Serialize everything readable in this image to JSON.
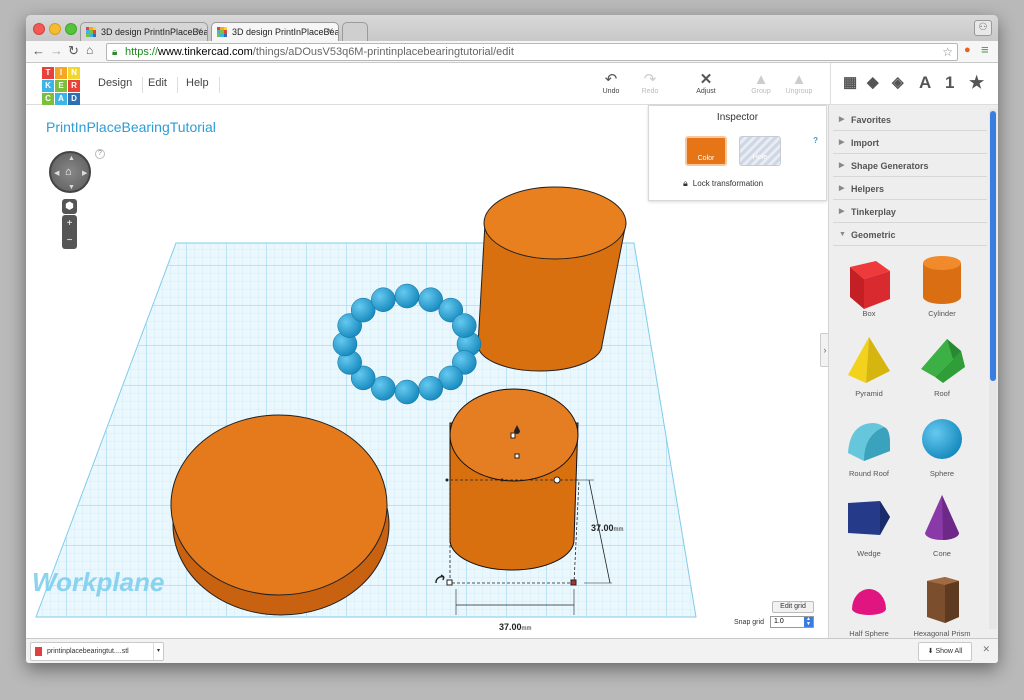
{
  "browser": {
    "tabs": [
      {
        "label": "3D design PrintInPlaceBea"
      },
      {
        "label": "3D design PrintInPlaceBea"
      }
    ],
    "url_https": "https://",
    "url_host": "www.tinkercad.com",
    "url_path": "/things/aDOusV53q6M-printinplacebearingtutorial/edit"
  },
  "app": {
    "logo_letters": [
      "T",
      "I",
      "N",
      "K",
      "E",
      "R",
      "C",
      "A",
      "D"
    ],
    "logo_colors": [
      "#e8413a",
      "#f6a623",
      "#f3d62b",
      "#3cb4e5",
      "#7bbf3f",
      "#e8413a",
      "#7bbf3f",
      "#3cb4e5",
      "#2c6fb3"
    ],
    "menu": [
      "Design",
      "Edit",
      "Help"
    ],
    "tools": [
      {
        "label": "Undo",
        "icon": "undo-icon",
        "enabled": true
      },
      {
        "label": "Redo",
        "icon": "redo-icon",
        "enabled": false
      },
      {
        "label": "Adjust",
        "icon": "adjust-icon",
        "enabled": true
      },
      {
        "label": "Group",
        "icon": "group-icon",
        "enabled": false
      },
      {
        "label": "Ungroup",
        "icon": "ungroup-icon",
        "enabled": false
      }
    ],
    "view_icons": [
      "grid-view-icon",
      "cube-solid-icon",
      "cube-wire-icon",
      "text-icon",
      "number-icon",
      "star-icon"
    ],
    "view_text": [
      "A",
      "1",
      "★"
    ]
  },
  "canvas": {
    "design_title": "PrintInPlaceBearingTutorial",
    "help": "?",
    "workplane_label": "Workplane",
    "dimension_height": "37.00",
    "dimension_width": "37.00",
    "dimension_unit": "mm",
    "edit_grid_label": "Edit grid",
    "snap_label": "Snap grid",
    "snap_value": "1.0"
  },
  "inspector": {
    "title": "Inspector",
    "color_label": "Color",
    "hole_label": "Hole",
    "help": "?",
    "lock_label": "Lock transformation",
    "selected_color": "#e57516"
  },
  "panel": {
    "categories": [
      "Favorites",
      "Import",
      "Shape Generators",
      "Helpers",
      "Tinkerplay",
      "Geometric"
    ],
    "shapes": [
      {
        "label": "Box",
        "icon": "box-icon"
      },
      {
        "label": "Cylinder",
        "icon": "cylinder-icon"
      },
      {
        "label": "Pyramid",
        "icon": "pyramid-icon"
      },
      {
        "label": "Roof",
        "icon": "roof-icon"
      },
      {
        "label": "Round Roof",
        "icon": "round-roof-icon"
      },
      {
        "label": "Sphere",
        "icon": "sphere-icon"
      },
      {
        "label": "Wedge",
        "icon": "wedge-icon"
      },
      {
        "label": "Cone",
        "icon": "cone-icon"
      },
      {
        "label": "Half Sphere",
        "icon": "half-sphere-icon"
      },
      {
        "label": "Hexagonal Prism",
        "icon": "hexagonal-prism-icon"
      }
    ]
  },
  "downloads": {
    "file": "printinplacebearingtut....stl",
    "show_all": "Show All"
  }
}
